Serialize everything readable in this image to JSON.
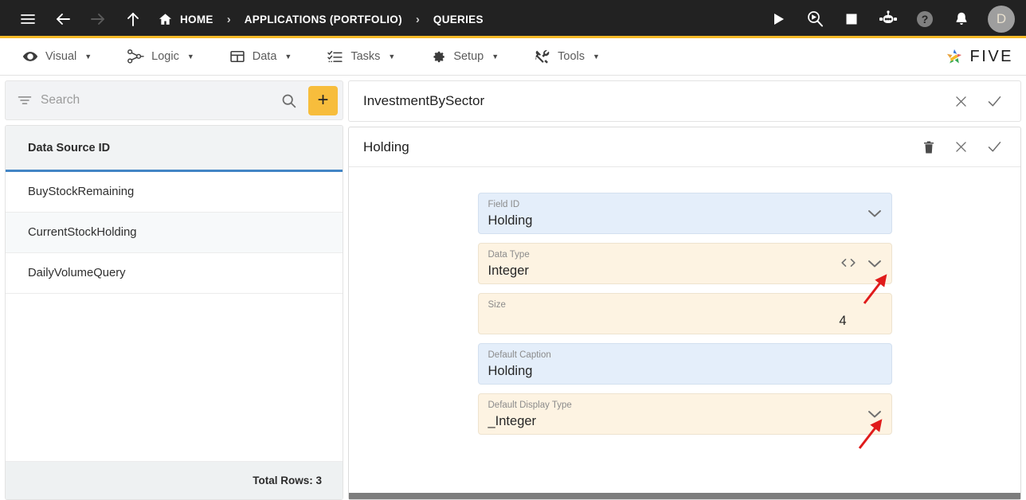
{
  "topbar": {
    "icons": [
      "menu-icon",
      "back-arrow-icon",
      "forward-arrow-icon",
      "up-arrow-icon"
    ],
    "breadcrumb": [
      {
        "label": "HOME",
        "icon": "home-icon"
      },
      {
        "label": "APPLICATIONS (PORTFOLIO)",
        "icon": ""
      },
      {
        "label": "QUERIES",
        "icon": ""
      }
    ],
    "separator": "›",
    "right_icons": [
      "play-icon",
      "debug-search-icon",
      "stop-icon",
      "robot-icon",
      "help-icon",
      "bell-icon"
    ],
    "avatar_initial": "D"
  },
  "menubar": {
    "items": [
      {
        "label": "Visual",
        "icon": "eye-icon",
        "caret": "▼"
      },
      {
        "label": "Logic",
        "icon": "logic-nodes-icon",
        "caret": "▼"
      },
      {
        "label": "Data",
        "icon": "table-grid-icon",
        "caret": "▼"
      },
      {
        "label": "Tasks",
        "icon": "checklist-icon",
        "caret": "▼"
      },
      {
        "label": "Setup",
        "icon": "gear-icon",
        "caret": "▼"
      },
      {
        "label": "Tools",
        "icon": "tools-icon",
        "caret": "▼"
      }
    ],
    "logo_text": "FIVE"
  },
  "sidebar": {
    "search": {
      "placeholder": "Search",
      "value": "",
      "filter_icon": "filter-icon",
      "search_icon": "search-icon"
    },
    "add_button_label": "+",
    "list": {
      "column_header": "Data Source ID",
      "rows": [
        {
          "label": "BuyStockRemaining"
        },
        {
          "label": "CurrentStockHolding"
        },
        {
          "label": "DailyVolumeQuery"
        }
      ]
    },
    "footer": "Total Rows: 3"
  },
  "record_panel": {
    "title": "InvestmentBySector",
    "actions": [
      {
        "name": "close-icon",
        "glyph": "✕"
      },
      {
        "name": "confirm-check-icon",
        "glyph": "✓"
      }
    ]
  },
  "field_panel": {
    "title": "Holding",
    "actions": [
      {
        "name": "delete-icon",
        "glyph": "Ὕ1"
      },
      {
        "name": "close-icon",
        "glyph": "✕"
      },
      {
        "name": "confirm-check-icon",
        "glyph": "✓"
      }
    ],
    "fields": [
      {
        "label": "Field ID",
        "value": "Holding",
        "style": "blue",
        "align": "left",
        "has_dropdown": true,
        "has_code": false
      },
      {
        "label": "Data Type",
        "value": "Integer",
        "style": "cream",
        "align": "left",
        "has_dropdown": true,
        "has_code": true
      },
      {
        "label": "Size",
        "value": "4",
        "style": "cream",
        "align": "right",
        "has_dropdown": false,
        "has_code": false
      },
      {
        "label": "Default Caption",
        "value": "Holding",
        "style": "blue",
        "align": "left",
        "has_dropdown": false,
        "has_code": false
      },
      {
        "label": "Default Display Type",
        "value": "_Integer",
        "style": "cream",
        "align": "left",
        "has_dropdown": true,
        "has_code": false
      }
    ]
  },
  "annotations": {
    "arrow_color": "#e01b1b",
    "arrows": [
      {
        "name": "arrow-to-data-type-dropdown",
        "target": "Data Type dropdown chevron"
      },
      {
        "name": "arrow-to-default-display-type-dropdown",
        "target": "Default Display Type dropdown chevron"
      }
    ]
  },
  "colors": {
    "topbar_bg": "#222222",
    "accent_yellow": "#f5b927",
    "field_blue": "#e4eefa",
    "field_cream": "#fdf3e2",
    "list_underline_blue": "#4285c5",
    "arrow_red": "#e01b1b"
  }
}
